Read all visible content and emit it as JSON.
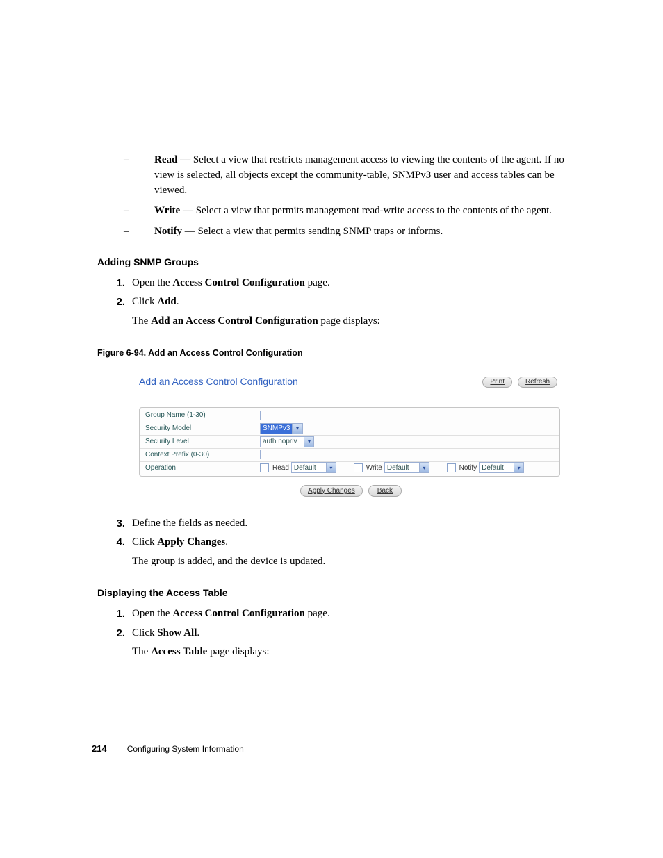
{
  "bullets": {
    "read": {
      "term": "Read",
      "desc": " — Select a view that restricts management access to viewing the contents of the agent. If no view is selected, all objects except the community-table, SNMPv3 user and access tables can be viewed."
    },
    "write": {
      "term": "Write",
      "desc": " — Select a view that permits management read-write access to the contents of the agent."
    },
    "notify": {
      "term": "Notify",
      "desc": " — Select a view that permits sending SNMP traps or informs."
    }
  },
  "add_section": {
    "heading": "Adding SNMP Groups",
    "steps": {
      "s1_num": "1.",
      "s1": "Open the ",
      "s1_bold": "Access Control Configuration",
      "s1_end": " page.",
      "s2_num": "2.",
      "s2": "Click ",
      "s2_bold": "Add",
      "s2_end": ".",
      "s2_follow_pre": "The ",
      "s2_follow_bold": "Add an Access Control Configuration",
      "s2_follow_end": " page displays:"
    }
  },
  "figure_caption": "Figure 6-94.    Add an Access Control Configuration",
  "panel": {
    "title": "Add an Access Control Configuration",
    "print": "Print",
    "refresh": "Refresh",
    "rows": {
      "group_name": "Group Name (1-30)",
      "security_model": "Security Model",
      "security_model_value": "SNMPv3",
      "security_level": "Security Level",
      "security_level_value": "auth nopriv",
      "context_prefix": "Context Prefix (0-30)",
      "operation": "Operation",
      "read": "Read",
      "read_val": "Default",
      "write": "Write",
      "write_val": "Default",
      "notify": "Notify",
      "notify_val": "Default"
    },
    "apply": "Apply Changes",
    "back": "Back"
  },
  "post_fig": {
    "s3_num": "3.",
    "s3": "Define the fields as needed.",
    "s4_num": "4.",
    "s4_pre": "Click ",
    "s4_bold": "Apply Changes",
    "s4_end": ".",
    "s4_follow": "The group is added, and the device is updated."
  },
  "display_section": {
    "heading": "Displaying the Access Table",
    "s1_num": "1.",
    "s1_pre": "Open the ",
    "s1_bold": "Access Control Configuration",
    "s1_end": " page.",
    "s2_num": "2.",
    "s2_pre": "Click ",
    "s2_bold": "Show All",
    "s2_end": ".",
    "s2_follow_pre": "The ",
    "s2_follow_bold": "Access Table",
    "s2_follow_end": " page displays:"
  },
  "footer": {
    "page": "214",
    "section": "Configuring System Information"
  }
}
